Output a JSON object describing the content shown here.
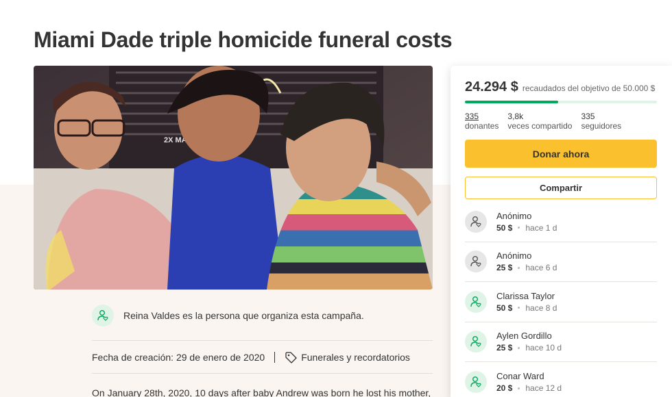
{
  "campaign": {
    "title": "Miami Dade triple homicide funeral costs",
    "organizer_text": "Reina Valdes es la persona que organiza esta campaña.",
    "created_text": "Fecha de creación: 29 de enero de 2020",
    "category": "Funerales y recordatorios",
    "story_start": "On January 28th, 2020, 10 days after baby Andrew was born he lost his mother,"
  },
  "photo": {
    "sign_text": "2X MA"
  },
  "donation_card": {
    "raised_amount": "24.294 $",
    "raised_goal_text": "recaudados del objetivo de 50.000 $",
    "progress_fraction": 0.486,
    "stats": [
      {
        "number": "335",
        "label": "donantes"
      },
      {
        "number": "3,8k",
        "label": "veces compartido"
      },
      {
        "number": "335",
        "label": "seguidores"
      }
    ],
    "donate_label": "Donar ahora",
    "share_label": "Compartir",
    "donors": [
      {
        "name": "Anónimo",
        "amount": "50 $",
        "time": "hace 1 d",
        "avatar": "gray"
      },
      {
        "name": "Anónimo",
        "amount": "25 $",
        "time": "hace 6 d",
        "avatar": "gray"
      },
      {
        "name": "Clarissa Taylor",
        "amount": "50 $",
        "time": "hace 8 d",
        "avatar": "green"
      },
      {
        "name": "Aylen Gordillo",
        "amount": "25 $",
        "time": "hace 10 d",
        "avatar": "green"
      },
      {
        "name": "Conar Ward",
        "amount": "20 $",
        "time": "hace 12 d",
        "avatar": "green"
      }
    ]
  },
  "colors": {
    "accent_green": "#02a95c",
    "donate_yellow": "#fbc02d",
    "page_band": "#faf5f1"
  }
}
